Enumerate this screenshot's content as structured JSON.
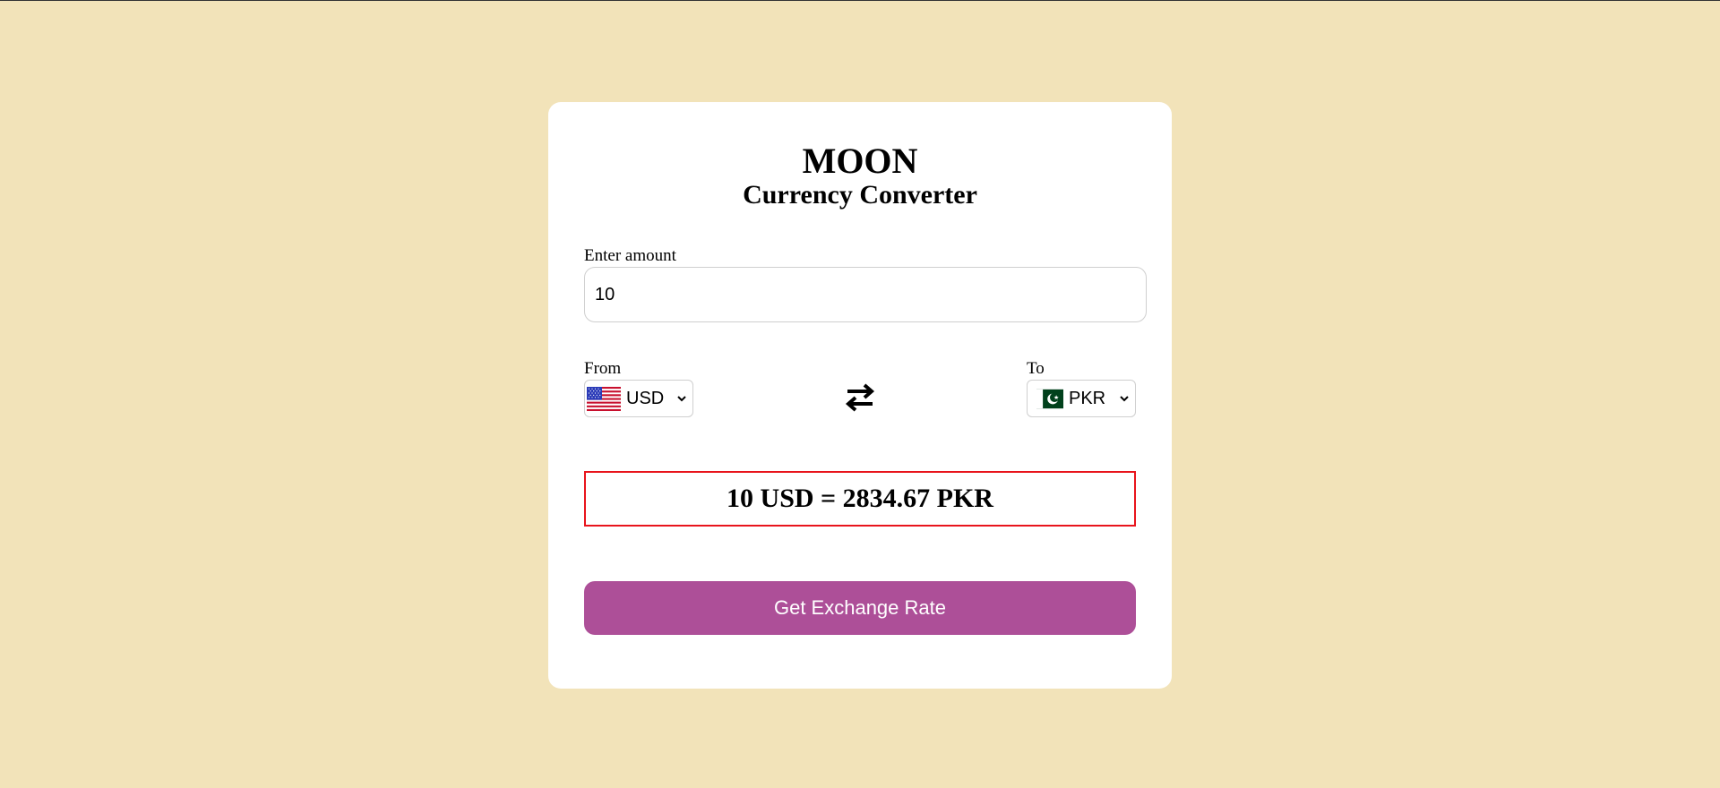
{
  "app": {
    "brand": "MOON",
    "subtitle": "Currency Converter"
  },
  "amount": {
    "label": "Enter amount",
    "value": "10"
  },
  "from": {
    "label": "From",
    "currency": "USD",
    "flag": "us-flag-icon"
  },
  "to": {
    "label": "To",
    "currency": "PKR",
    "flag": "pk-flag-icon"
  },
  "swap_icon": "swap-arrows-icon",
  "result": {
    "text": "10 USD = 2834.67 PKR"
  },
  "button": {
    "label": "Get Exchange Rate"
  },
  "colors": {
    "page_background": "#f2e3b9",
    "card_background": "#ffffff",
    "button": "#ad4f98",
    "result_border": "#e8141c"
  }
}
